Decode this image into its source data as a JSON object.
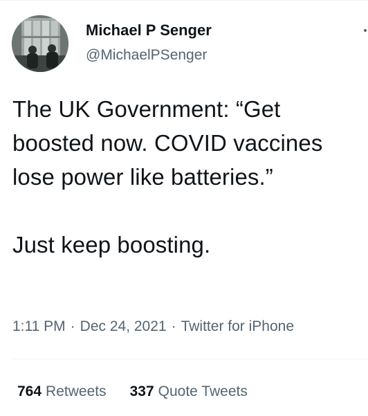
{
  "author": {
    "name": "Michael P Senger",
    "handle": "@MichaelPSenger",
    "avatar": "profile-photo"
  },
  "tweet": {
    "text": "The UK Government: “Get boosted now. COVID vaccines lose power like batteries.”\n\nJust keep boosting.",
    "time": "1:11 PM",
    "date": "Dec 24, 2021",
    "separator": "·",
    "source": "Twitter for iPhone"
  },
  "stats": {
    "retweets_count": "764",
    "retweets_label": "Retweets",
    "quotes_count": "337",
    "quotes_label": "Quote Tweets"
  },
  "icons": {
    "more": "more-icon"
  },
  "colors": {
    "text_primary": "#0f1419",
    "text_secondary": "#536471",
    "divider": "#eff3f4"
  }
}
